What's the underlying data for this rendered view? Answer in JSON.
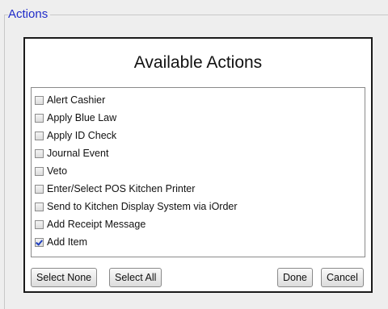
{
  "fieldset": {
    "legend": "Actions"
  },
  "dialog": {
    "title": "Available Actions",
    "items": [
      {
        "label": "Alert Cashier",
        "checked": false
      },
      {
        "label": "Apply Blue Law",
        "checked": false
      },
      {
        "label": "Apply ID Check",
        "checked": false
      },
      {
        "label": "Journal Event",
        "checked": false
      },
      {
        "label": "Veto",
        "checked": false
      },
      {
        "label": "Enter/Select POS Kitchen Printer",
        "checked": false
      },
      {
        "label": "Send to Kitchen Display System via iOrder",
        "checked": false
      },
      {
        "label": "Add Receipt Message",
        "checked": false
      },
      {
        "label": "Add Item",
        "checked": true
      }
    ],
    "buttons": {
      "select_none": "Select None",
      "select_all": "Select All",
      "done": "Done",
      "cancel": "Cancel"
    }
  },
  "colors": {
    "legend": "#1f2bc9",
    "check": "#1f3fbf",
    "border": "#1a1a1a"
  }
}
